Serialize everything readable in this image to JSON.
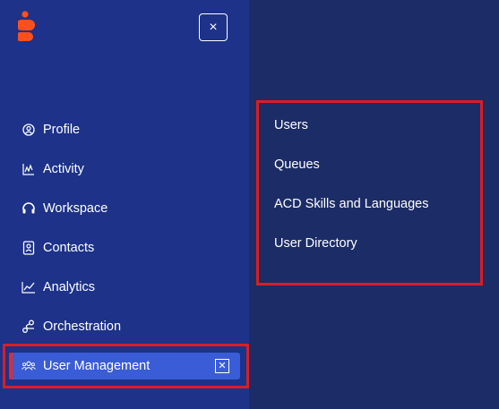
{
  "close_label": "×",
  "nav": {
    "items": [
      {
        "label": "Profile",
        "icon": "profile-icon"
      },
      {
        "label": "Activity",
        "icon": "activity-icon"
      },
      {
        "label": "Workspace",
        "icon": "headset-icon"
      },
      {
        "label": "Contacts",
        "icon": "contacts-icon"
      },
      {
        "label": "Analytics",
        "icon": "analytics-icon"
      },
      {
        "label": "Orchestration",
        "icon": "orchestration-icon"
      },
      {
        "label": "User Management",
        "icon": "users-icon"
      }
    ],
    "active_close_label": "✕"
  },
  "submenu": {
    "items": [
      {
        "label": "Users"
      },
      {
        "label": "Queues"
      },
      {
        "label": "ACD Skills and Languages"
      },
      {
        "label": "User Directory"
      }
    ]
  },
  "colors": {
    "sidebar_bg": "#1d3288",
    "main_bg": "#1c2c66",
    "active_bg": "#3a5cd6",
    "highlight": "#d91e26",
    "logo": "#ff4f1f"
  }
}
